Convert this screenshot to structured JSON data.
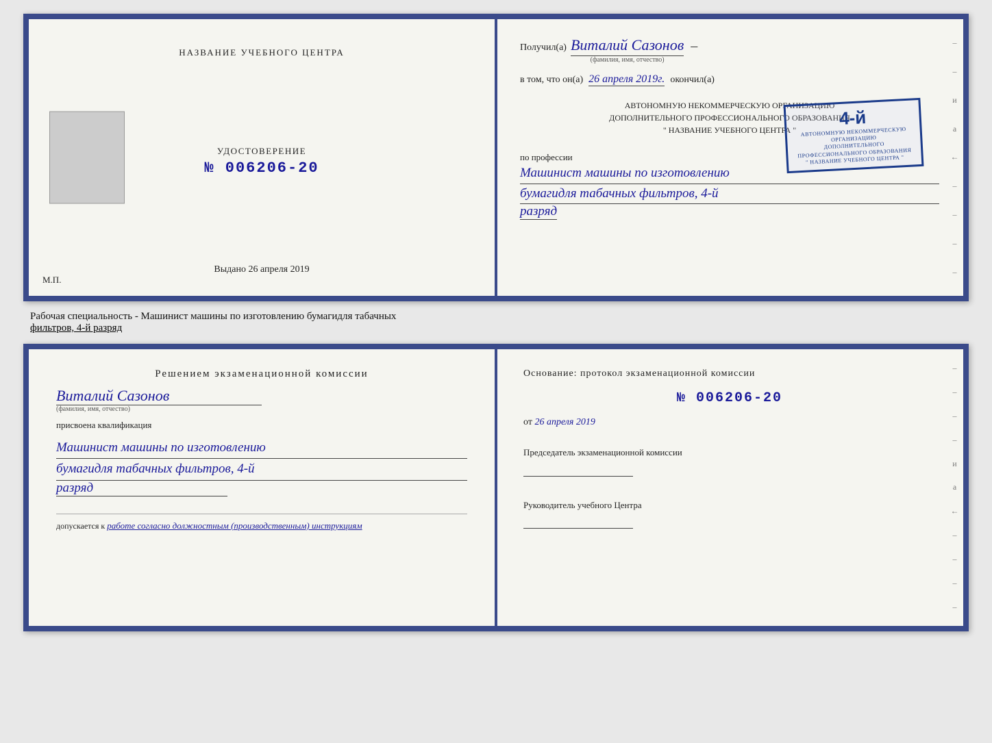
{
  "top_cert": {
    "left": {
      "title_line1": "НАЗВАНИЕ УЧЕБНОГО ЦЕНТРА",
      "cert_label": "УДОСТОВЕРЕНИЕ",
      "cert_number": "№ 006206-20",
      "issued_label": "Выдано",
      "issued_date": "26 апреля 2019",
      "mp_label": "М.П."
    },
    "right": {
      "received_prefix": "Получил(а)",
      "name_handwritten": "Виталий Сазонов",
      "name_small_label": "(фамилия, имя, отчество)",
      "in_that_prefix": "в том, что он(а)",
      "date_handwritten": "26 апреля 2019г.",
      "finished_label": "окончил(а)",
      "stamp_number": "4-й",
      "org_line1": "АВТОНОМНУЮ НЕКОММЕРЧЕСКУЮ ОРГАНИЗАЦИЮ",
      "org_line2": "ДОПОЛНИТЕЛЬНОГО ПРОФЕССИОНАЛЬНОГО ОБРАЗОВАНИЯ",
      "org_line3": "\" НАЗВАНИЕ УЧЕБНОГО ЦЕНТРА \"",
      "profession_prefix": "по профессии",
      "profession_hw1": "Машинист машины по изготовлению",
      "profession_hw2": "бумагидля табачных фильтров, 4-й",
      "profession_hw3": "разряд"
    }
  },
  "middle_label": {
    "text_normal": "Рабочая специальность - Машинист машины по изготовлению бумагидля табачных",
    "text_underline": "фильтров, 4-й разряд"
  },
  "bottom_cert": {
    "left": {
      "title": "Решением экзаменационной комиссии",
      "name_hw": "Виталий Сазонов",
      "name_small": "(фамилия, имя, отчество)",
      "assigned_label": "присвоена квалификация",
      "profession_hw1": "Машинист машины по изготовлению",
      "profession_hw2": "бумагидля табачных фильтров, 4-й",
      "profession_hw3": "разряд",
      "dopusk_prefix": "допускается к",
      "dopusk_hw": "работе согласно должностным (производственным) инструкциям"
    },
    "right": {
      "basis_label": "Основание: протокол экзаменационной комиссии",
      "number_label": "№ 006206-20",
      "date_prefix": "от",
      "date_value": "26 апреля 2019",
      "chairman_label": "Председатель экзаменационной комиссии",
      "head_label": "Руководитель учебного Центра"
    }
  }
}
